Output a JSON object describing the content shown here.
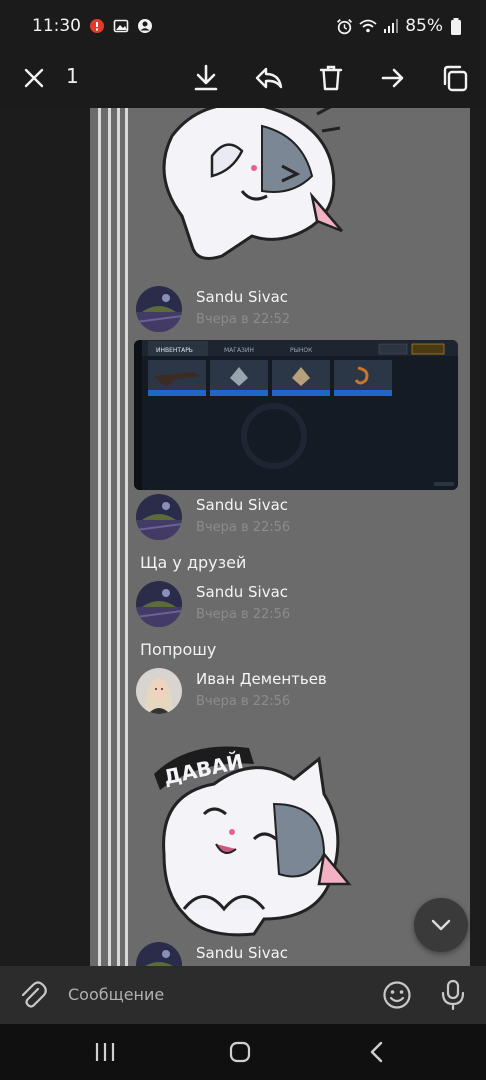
{
  "status_bar": {
    "time": "11:30",
    "battery": "85%",
    "icons": [
      "alert-icon",
      "image-icon",
      "account-icon",
      "alarm-icon",
      "wifi-icon",
      "signal-icon",
      "battery-icon"
    ]
  },
  "toolbar": {
    "selected_count": "1",
    "actions": [
      "close-icon",
      "download-icon",
      "reply-icon",
      "delete-icon",
      "forward-icon",
      "copy-icon"
    ]
  },
  "messages": [
    {
      "type": "sticker",
      "sticker": "cat-facepalm-sticker"
    },
    {
      "type": "image",
      "author": "Sandu Sivac",
      "time": "Вчера в 22:52",
      "screenshot": {
        "tabs": [
          "ИНВЕНТАРЬ",
          "МАГАЗИН",
          "РЫНОК"
        ]
      }
    },
    {
      "type": "text",
      "author": "Sandu Sivac",
      "time": "Вчера в 22:56",
      "text": "Ща у друзей"
    },
    {
      "type": "text",
      "author": "Sandu Sivac",
      "time": "Вчера в 22:56",
      "text": "Попрошу"
    },
    {
      "type": "sticker",
      "author": "Иван Дементьев",
      "time": "Вчера в 22:56",
      "sticker": "cat-davai-sticker",
      "sticker_text": "ДАВАЙ"
    },
    {
      "type": "partial",
      "author": "Sandu Sivac"
    }
  ],
  "input": {
    "placeholder": "Сообщение",
    "icons": [
      "attach-icon",
      "emoji-icon",
      "microphone-icon"
    ]
  },
  "nav": {
    "icons": [
      "recent-apps-icon",
      "home-icon",
      "back-icon"
    ]
  },
  "colors": {
    "chat_bg": "#6b6b6b",
    "bar_bg": "#1b1b1b",
    "input_bg": "#2c2c2c"
  }
}
